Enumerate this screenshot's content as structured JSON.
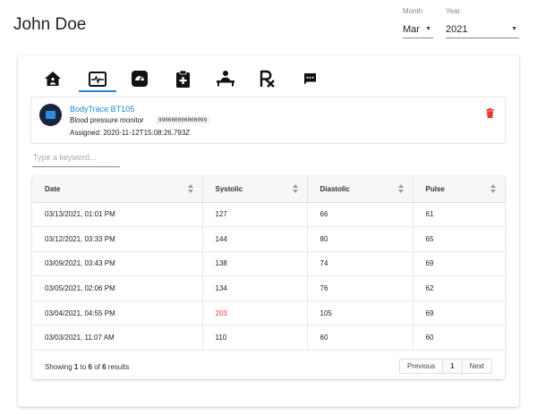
{
  "patient": {
    "name": "John Doe"
  },
  "filters": {
    "month_label": "Month",
    "month_value": "Mar",
    "year_label": "Year",
    "year_value": "2021"
  },
  "tabs": [
    {
      "icon": "home-icon",
      "active": false
    },
    {
      "icon": "monitor-heart-icon",
      "active": true
    },
    {
      "icon": "scale-icon",
      "active": false
    },
    {
      "icon": "medical-clipboard-icon",
      "active": false
    },
    {
      "icon": "patient-bed-icon",
      "active": false
    },
    {
      "icon": "prescription-rx-icon",
      "active": false
    },
    {
      "icon": "chat-icon",
      "active": false
    }
  ],
  "device": {
    "name": "BodyTrace BT105",
    "type": "Blood pressure monitor",
    "serial": "990000000000099",
    "assigned": "Assigned: 2020-11-12T15:08:26.793Z"
  },
  "search": {
    "placeholder": "Type a keyword..."
  },
  "table": {
    "columns": [
      "Date",
      "Systolic",
      "Diastolic",
      "Pulse"
    ],
    "rows": [
      {
        "date": "03/13/2021, 01:01 PM",
        "systolic": "127",
        "diastolic": "66",
        "pulse": "61",
        "alert": false
      },
      {
        "date": "03/12/2021, 03:33 PM",
        "systolic": "144",
        "diastolic": "80",
        "pulse": "65",
        "alert": false
      },
      {
        "date": "03/09/2021, 03:43 PM",
        "systolic": "138",
        "diastolic": "74",
        "pulse": "69",
        "alert": false
      },
      {
        "date": "03/05/2021, 02:06 PM",
        "systolic": "134",
        "diastolic": "76",
        "pulse": "62",
        "alert": false
      },
      {
        "date": "03/04/2021, 04:55 PM",
        "systolic": "203",
        "diastolic": "105",
        "pulse": "69",
        "alert": true
      },
      {
        "date": "03/03/2021, 11:07 AM",
        "systolic": "110",
        "diastolic": "60",
        "pulse": "60",
        "alert": false
      }
    ],
    "footer": {
      "showing": "Showing",
      "from": "1",
      "to_word": "to",
      "to": "6",
      "of_word": "of",
      "total": "6",
      "results_word": "results"
    },
    "pagination": {
      "previous": "Previous",
      "current": "1",
      "next": "Next"
    }
  },
  "colors": {
    "accent": "#1e88d6",
    "alert": "#e53935",
    "delete": "#e53935"
  }
}
